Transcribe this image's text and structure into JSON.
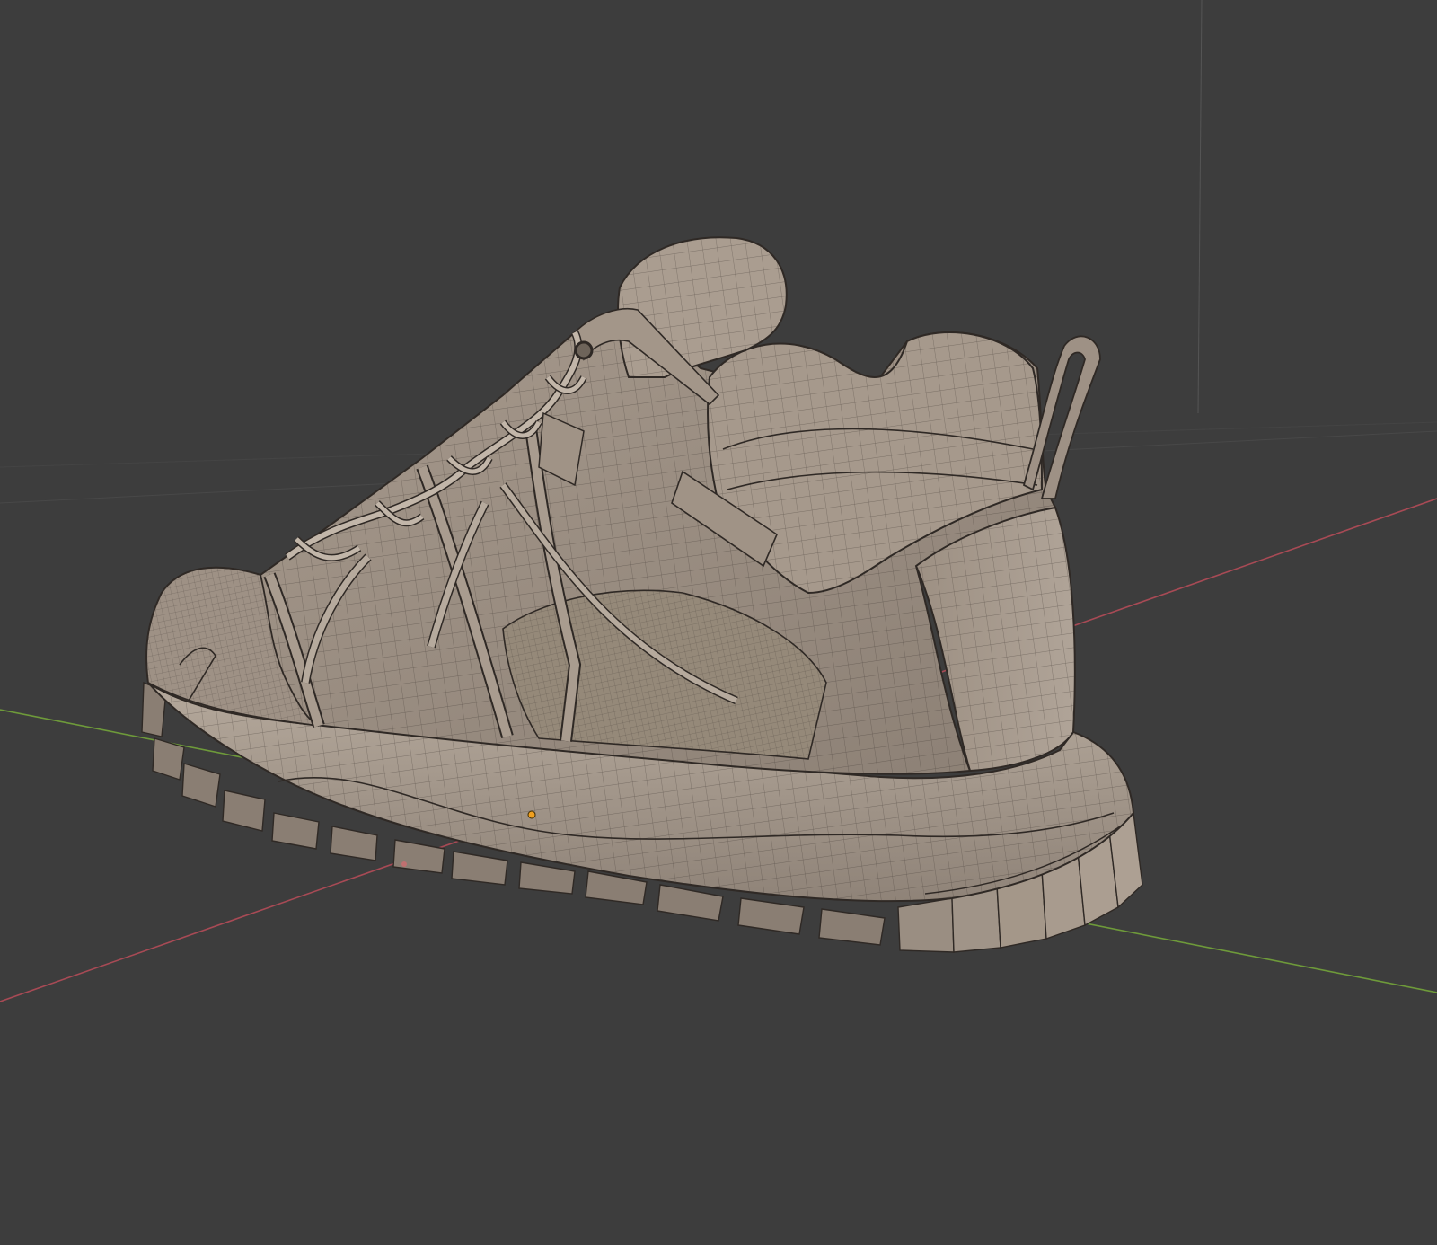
{
  "viewport": {
    "background_color": "#3d3d3d",
    "shading_mode": "solid",
    "wireframe_overlay": true
  },
  "scene": {
    "object": "sneaker-mesh",
    "mesh_color": "#a3968a",
    "mesh_shadow_color": "#6e645a",
    "wire_color": "#3a332d",
    "origin_point_color": "#f0a020"
  },
  "axes": {
    "x_axis_color": "#a84a55",
    "y_axis_color": "#6e9a3a",
    "z_axis_color": "#555555"
  }
}
